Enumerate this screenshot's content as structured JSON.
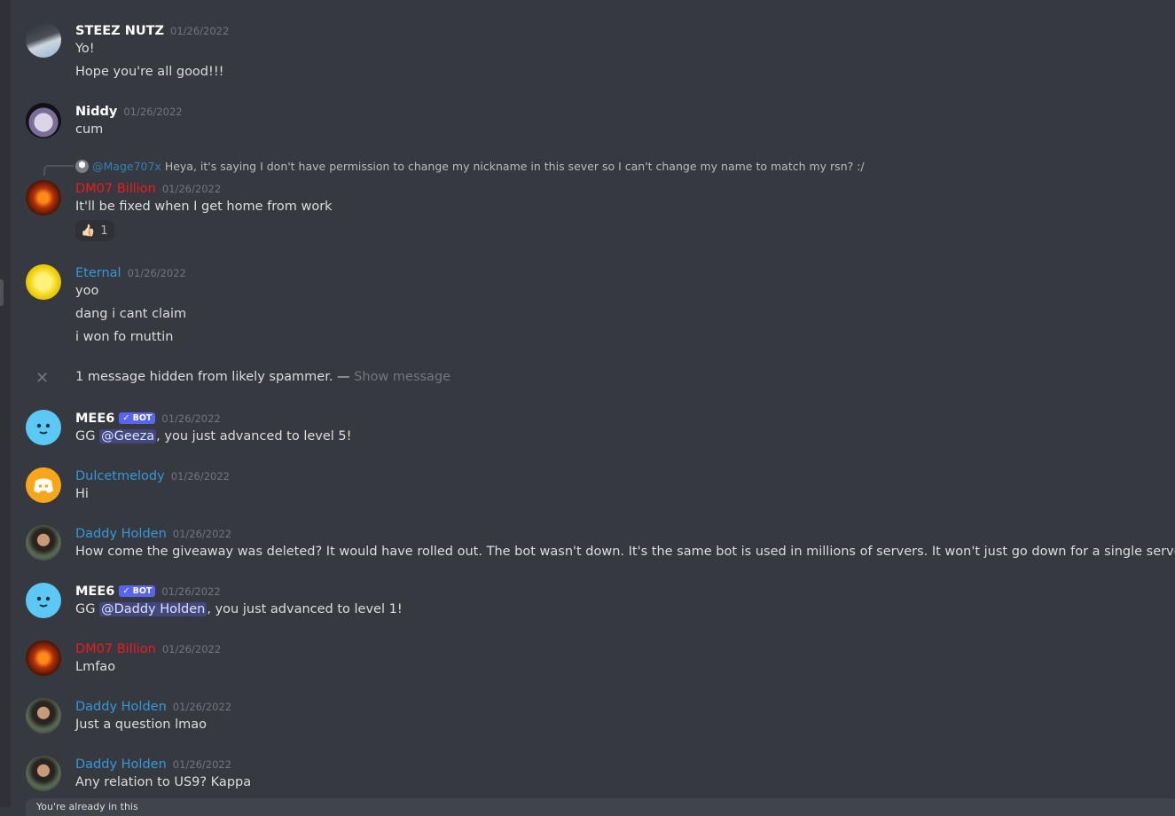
{
  "messages": [
    {
      "author": "STEEZ NUTZ",
      "timestamp": "01/26/2022",
      "lines": [
        "Yo!",
        "Hope you're all good!!!"
      ]
    },
    {
      "author": "Niddy",
      "timestamp": "01/26/2022",
      "lines": [
        "cum"
      ]
    },
    {
      "author": "DM07 Billion",
      "timestamp": "01/26/2022",
      "reply": {
        "author": "@Mage707x",
        "text": "Heya, it's saying I don't have permission to change my nickname in this sever so I can't change my name to match my rsn? :/"
      },
      "lines": [
        "It'll be fixed when I get home from work"
      ],
      "reaction": {
        "emoji": "👍🏻",
        "count": "1"
      }
    },
    {
      "author": "Eternal",
      "timestamp": "01/26/2022",
      "lines": [
        "yoo",
        "dang i cant claim",
        "i won fo rnuttin"
      ]
    },
    {
      "author": "MEE6",
      "badge": "✓ BOT",
      "timestamp": "01/26/2022",
      "pre": "GG ",
      "mention": "@Geeza",
      "post": ", you just advanced to level 5!"
    },
    {
      "author": "Dulcetmelody",
      "timestamp": "01/26/2022",
      "lines": [
        "Hi"
      ]
    },
    {
      "author": "Daddy Holden",
      "timestamp": "01/26/2022",
      "lines": [
        "How come the giveaway was deleted? It would have rolled out. The bot wasn't down. It's the same bot is used in millions of servers. It won't just go down for a single server. Lol"
      ]
    },
    {
      "author": "MEE6",
      "badge": "✓ BOT",
      "timestamp": "01/26/2022",
      "pre": "GG ",
      "mention": "@Daddy Holden",
      "post": ", you just advanced to level 1!"
    },
    {
      "author": "DM07 Billion",
      "timestamp": "01/26/2022",
      "lines": [
        "Lmfao"
      ]
    },
    {
      "author": "Daddy Holden",
      "timestamp": "01/26/2022",
      "lines": [
        "Just a question lmao"
      ]
    },
    {
      "author": "Daddy Holden",
      "timestamp": "01/26/2022",
      "lines": [
        "Any relation to US9? Kappa"
      ]
    }
  ],
  "hidden_notice": {
    "text": "1 message hidden from likely spammer. — ",
    "action": "Show message",
    "icon": "close-icon"
  },
  "composer": {
    "partial_text": "You're already in this"
  },
  "colors": {
    "background": "#36393f",
    "username_red": "#ed1c1c",
    "username_blue": "#3498db",
    "bot_badge": "#5865f2"
  }
}
